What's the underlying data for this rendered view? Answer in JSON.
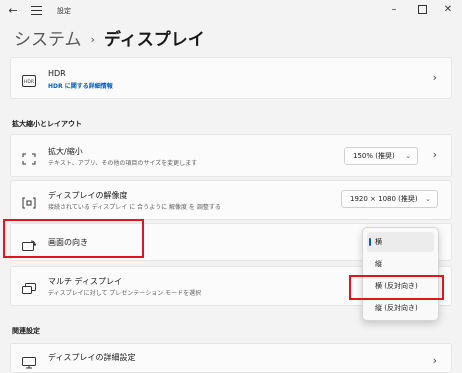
{
  "titlebar": {
    "title": "設定"
  },
  "breadcrumb": {
    "parent": "システム",
    "separator": "›",
    "current": "ディスプレイ"
  },
  "hdr": {
    "title": "HDR",
    "link": "HDR に関する詳細情報",
    "icon": "HDR"
  },
  "sections": {
    "scale_layout": "拡大縮小とレイアウト",
    "related": "関連設定"
  },
  "scale": {
    "title": "拡大/縮小",
    "description": "テキスト、アプリ、その他の項目のサイズを変更します",
    "value": "150% (推奨)"
  },
  "resolution": {
    "title": "ディスプレイの解像度",
    "description": "接続されている ディスプレイ に 合うように 解像度 を 調整する",
    "value": "1920 × 1080 (推奨)"
  },
  "orientation": {
    "title": "画面の向き",
    "options": [
      "横",
      "縦",
      "横 (反対向き)",
      "縦 (反対向き)"
    ],
    "selected": "横"
  },
  "multi": {
    "title": "マルチ ディスプレイ",
    "description": "ディスプレイに対して プレゼンテーション モードを選択"
  },
  "advanced": {
    "title": "ディスプレイの詳細設定"
  },
  "colors": {
    "accent": "#005fb8",
    "highlight": "#e0161e"
  }
}
